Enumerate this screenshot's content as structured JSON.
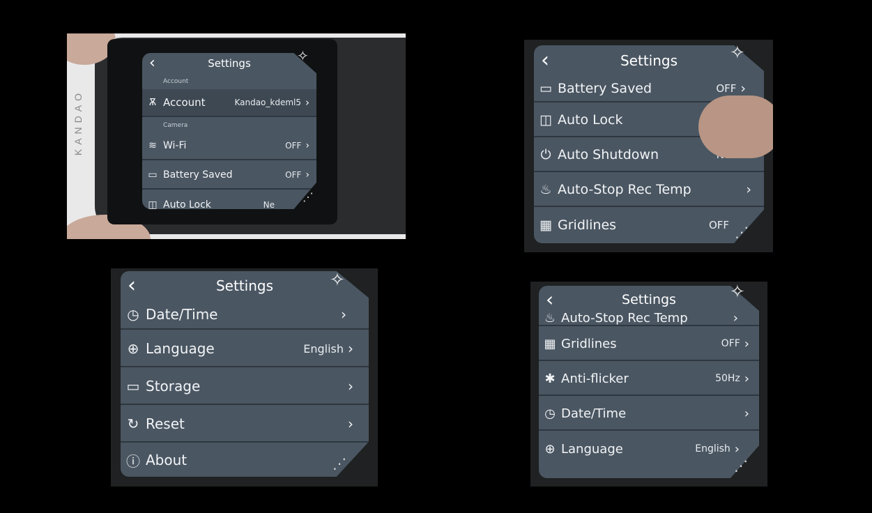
{
  "header": {
    "title": "Settings",
    "back_glyph": "‹"
  },
  "panel1": {
    "brand": "KANDAO",
    "section_account": "Account",
    "section_camera": "Camera",
    "rows": [
      {
        "icon": "user-icon",
        "glyph": "Ѫ",
        "label": "Account",
        "value": "Kandao_kdeml5",
        "chev": "›"
      },
      {
        "icon": "wifi-icon",
        "glyph": "≋",
        "label": "Wi-Fi",
        "value": "OFF",
        "chev": "›"
      },
      {
        "icon": "battery-icon",
        "glyph": "▭",
        "label": "Battery Saved",
        "value": "OFF",
        "chev": "›"
      },
      {
        "icon": "lock-icon",
        "glyph": "◫",
        "label": "Auto Lock",
        "value": "Ne",
        "chev": ""
      }
    ]
  },
  "panel2": {
    "rows": [
      {
        "icon": "battery-icon",
        "glyph": "▭",
        "label": "Battery Saved",
        "value": "OFF",
        "chev": "›"
      },
      {
        "icon": "lock-icon",
        "glyph": "◫",
        "label": "Auto Lock",
        "value": "",
        "chev": ""
      },
      {
        "icon": "power-icon",
        "glyph": "⏻",
        "label": "Auto Shutdown",
        "value": "Never",
        "chev": "›"
      },
      {
        "icon": "thermometer-icon",
        "glyph": "♨",
        "label": "Auto-Stop Rec Temp",
        "value": "",
        "chev": "›"
      },
      {
        "icon": "grid-icon",
        "glyph": "▦",
        "label": "Gridlines",
        "value": "OFF",
        "chev": ""
      }
    ]
  },
  "panel3": {
    "rows": [
      {
        "icon": "clock-icon",
        "glyph": "◷",
        "label": "Date/Time",
        "value": "",
        "chev": "›"
      },
      {
        "icon": "globe-icon",
        "glyph": "⊕",
        "label": "Language",
        "value": "English",
        "chev": "›"
      },
      {
        "icon": "storage-icon",
        "glyph": "▭",
        "label": "Storage",
        "value": "",
        "chev": "›"
      },
      {
        "icon": "reset-icon",
        "glyph": "↻",
        "label": "Reset",
        "value": "",
        "chev": "›"
      },
      {
        "icon": "info-icon",
        "glyph": "ⓘ",
        "label": "About",
        "value": "",
        "chev": ""
      }
    ]
  },
  "panel4": {
    "rows": [
      {
        "icon": "thermometer-icon",
        "glyph": "♨",
        "label": "Auto-Stop Rec Temp",
        "value": "",
        "chev": "›"
      },
      {
        "icon": "grid-icon",
        "glyph": "▦",
        "label": "Gridlines",
        "value": "OFF",
        "chev": "›"
      },
      {
        "icon": "antiflicker-icon",
        "glyph": "✱",
        "label": "Anti-flicker",
        "value": "50Hz",
        "chev": "›"
      },
      {
        "icon": "clock-icon",
        "glyph": "◷",
        "label": "Date/Time",
        "value": "",
        "chev": "›"
      },
      {
        "icon": "globe-icon",
        "glyph": "⊕",
        "label": "Language",
        "value": "English",
        "chev": "›"
      }
    ]
  }
}
